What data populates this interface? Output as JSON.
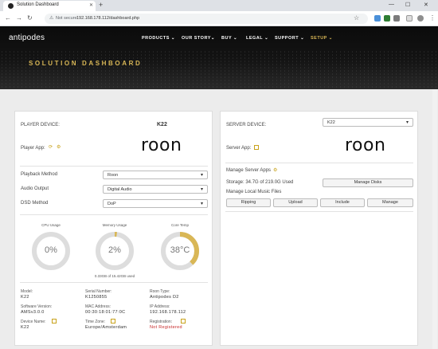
{
  "browser": {
    "tab_title": "Solution Dashboard",
    "not_secure": "Not secure",
    "url": "192.168.178.112/dashboard.php"
  },
  "site": {
    "logo": "antipodes",
    "menu": [
      "PRODUCTS ⌄",
      "OUR STORY⌄",
      "BUY ⌄",
      "LEGAL ⌄",
      "SUPPORT ⌄",
      "SETUP ⌄"
    ],
    "active_menu": "SETUP ⌄",
    "hero_title": "SOLUTION DASHBOARD"
  },
  "player": {
    "device_label": "PLAYER DEVICE:",
    "device_name": "K22",
    "app_label": "Player App:",
    "app_logo": "roon",
    "playback_label": "Playback Method",
    "playback_value": "Roon",
    "audio_label": "Audio Output",
    "audio_value": "Digital Audio",
    "dsd_label": "DSD Method",
    "dsd_value": "DoP",
    "gauges": [
      {
        "label": "CPU Usage",
        "value": "0%",
        "percent": 0
      },
      {
        "label": "Memory Usage",
        "value": "2%",
        "percent": 2
      },
      {
        "label": "Core Temp",
        "value": "38°C",
        "percent": 38
      }
    ],
    "memory_detail": "0.33GB of 15.42GB used",
    "info": {
      "model_k": "Model:",
      "model_v": "K22",
      "serial_k": "Serial Number:",
      "serial_v": "K1250855",
      "roon_type_k": "Roon Type:",
      "roon_type_v": "Antipodes D2",
      "sw_k": "Software Version:",
      "sw_v": "AMSv3.0.0",
      "mac_k": "MAC Address:",
      "mac_v": "00:30:18:01:77:0C",
      "ip_k": "IP Address:",
      "ip_v": "192.168.178.112",
      "devname_k": "Device Name:",
      "devname_v": "K22",
      "tz_k": "Time Zone:",
      "tz_v": "Europe/Amsterdam",
      "reg_k": "Registration:",
      "reg_v": "Not Registered"
    }
  },
  "server": {
    "device_label": "SERVER DEVICE:",
    "device_value": "K22",
    "app_label": "Server App:",
    "app_logo": "roon",
    "manage_apps": "Manage Server Apps",
    "storage": "Storage: 34.7G of 219.0G Used",
    "manage_disks": "Manage Disks",
    "manage_music": "Manage Local Music Files",
    "buttons": [
      "Ripping",
      "Upload",
      "Include",
      "Manage"
    ]
  },
  "colors": {
    "accent": "#d9b756",
    "gauge_track": "#dddddd",
    "danger": "#c62828"
  }
}
